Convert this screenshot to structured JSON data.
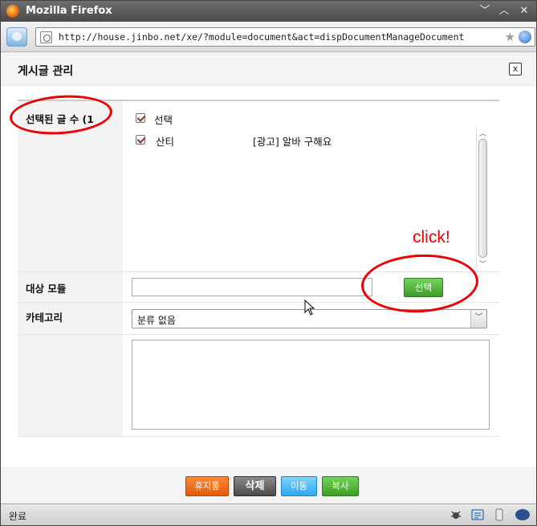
{
  "window": {
    "title": "Mozilla Firefox",
    "url": "http://house.jinbo.net/xe/?module=document&act=dispDocumentManageDocument",
    "status": "완료"
  },
  "popup": {
    "title": "게시글 관리",
    "close_label": "x",
    "selected_count_label": "선택된 글 수 (1",
    "select_all_label": "선택",
    "items": [
      {
        "author": "산티",
        "subject": "[광고] 알바 구해요"
      }
    ],
    "target_module_label": "대상 모듈",
    "target_module_value": "",
    "select_button": "선택",
    "category_label": "카테고리",
    "category_value": "분류 없음",
    "message_value": ""
  },
  "footer": {
    "trash": "휴지통",
    "delete": "삭제",
    "move": "이동",
    "copy": "복사"
  },
  "annotation": {
    "click_text": "click!",
    "color": "#e00000"
  }
}
